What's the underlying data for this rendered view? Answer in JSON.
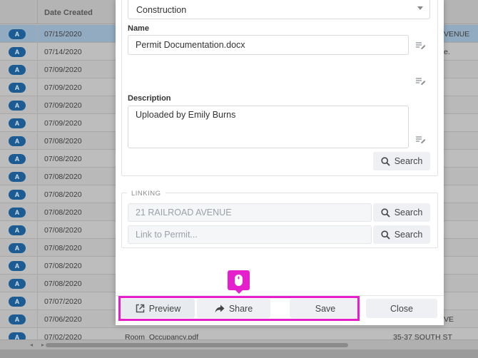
{
  "grid": {
    "header": {
      "date_created": "Date Created"
    },
    "rows": [
      {
        "badge": "A",
        "date": "07/15/2020",
        "file": "",
        "addr": "VENUE",
        "selected": true
      },
      {
        "badge": "A",
        "date": "07/14/2020",
        "file": "",
        "addr": "e."
      },
      {
        "badge": "A",
        "date": "07/09/2020",
        "file": "",
        "addr": ""
      },
      {
        "badge": "A",
        "date": "07/09/2020",
        "file": "",
        "addr": ""
      },
      {
        "badge": "A",
        "date": "07/09/2020",
        "file": "",
        "addr": ""
      },
      {
        "badge": "A",
        "date": "07/09/2020",
        "file": "",
        "addr": ""
      },
      {
        "badge": "A",
        "date": "07/08/2020",
        "file": "",
        "addr": ""
      },
      {
        "badge": "A",
        "date": "07/08/2020",
        "file": "",
        "addr": ""
      },
      {
        "badge": "A",
        "date": "07/08/2020",
        "file": "",
        "addr": ""
      },
      {
        "badge": "A",
        "date": "07/08/2020",
        "file": "",
        "addr": ""
      },
      {
        "badge": "A",
        "date": "07/08/2020",
        "file": "",
        "addr": ""
      },
      {
        "badge": "A",
        "date": "07/08/2020",
        "file": "",
        "addr": ""
      },
      {
        "badge": "A",
        "date": "07/08/2020",
        "file": "",
        "addr": ""
      },
      {
        "badge": "A",
        "date": "07/08/2020",
        "file": "",
        "addr": ""
      },
      {
        "badge": "A",
        "date": "07/08/2020",
        "file": "",
        "addr": ""
      },
      {
        "badge": "A",
        "date": "07/07/2020",
        "file": "",
        "addr": ""
      },
      {
        "badge": "A",
        "date": "07/06/2020",
        "file": "",
        "addr": "VE"
      },
      {
        "badge": "A",
        "date": "07/02/2020",
        "file": "Room_Occupancy.pdf",
        "addr": "35-37 SOUTH ST"
      }
    ]
  },
  "form": {
    "category_value": "Construction",
    "name_label": "Name",
    "name_value": "Permit Documentation.docx",
    "description_label": "Description",
    "description_value": "Uploaded by Emily Burns",
    "search_button": "Search",
    "linking_legend": "LINKING",
    "address_placeholder": "21 RAILROAD AVENUE",
    "permit_placeholder": "Link to Permit...",
    "address_search_button": "Search",
    "permit_search_button": "Search"
  },
  "footer": {
    "preview": "Preview",
    "share": "Share",
    "save": "Save",
    "close": "Close"
  },
  "colors": {
    "highlight": "#e61fcc",
    "badge": "#1d5c93"
  },
  "icons": [
    "edit-list-icon",
    "search-icon",
    "external-link-icon",
    "share-arrow-icon",
    "mouse-icon",
    "chevron-down-icon"
  ]
}
